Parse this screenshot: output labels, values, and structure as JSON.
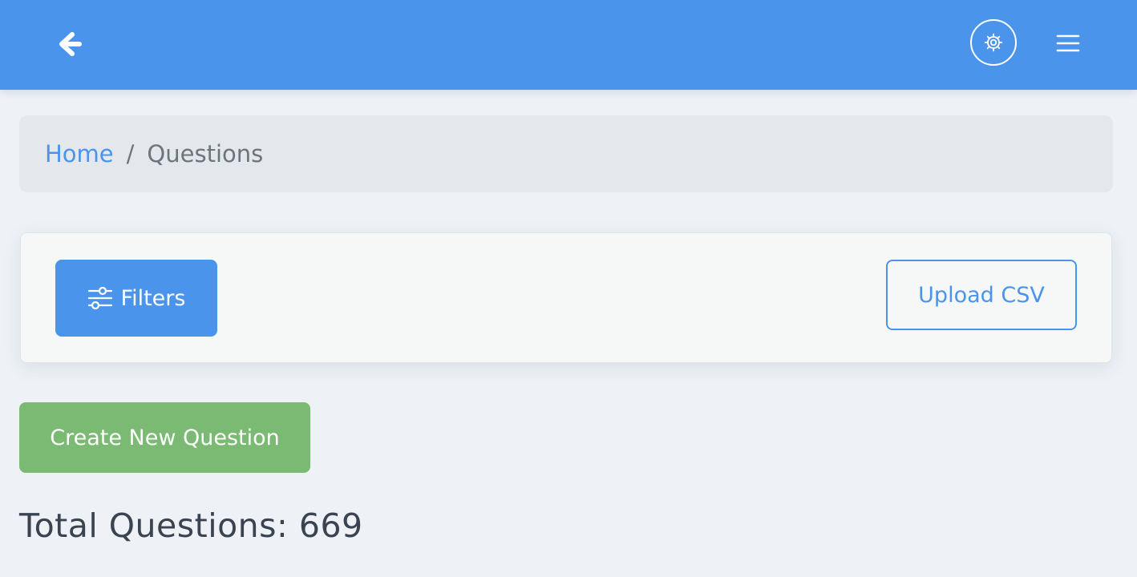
{
  "header": {
    "back_icon": "arrow-left-icon",
    "settings_icon": "gear-icon",
    "menu_icon": "hamburger-menu-icon",
    "bar_color": "#4a94ec"
  },
  "breadcrumb": {
    "home_label": "Home",
    "separator": "/",
    "current_label": "Questions"
  },
  "filters": {
    "filters_label": "Filters",
    "filters_icon": "sliders-icon",
    "upload_label": "Upload CSV"
  },
  "actions": {
    "create_label": "Create New Question",
    "create_color": "#7aba72"
  },
  "summary": {
    "total_text": "Total Questions: 669"
  }
}
